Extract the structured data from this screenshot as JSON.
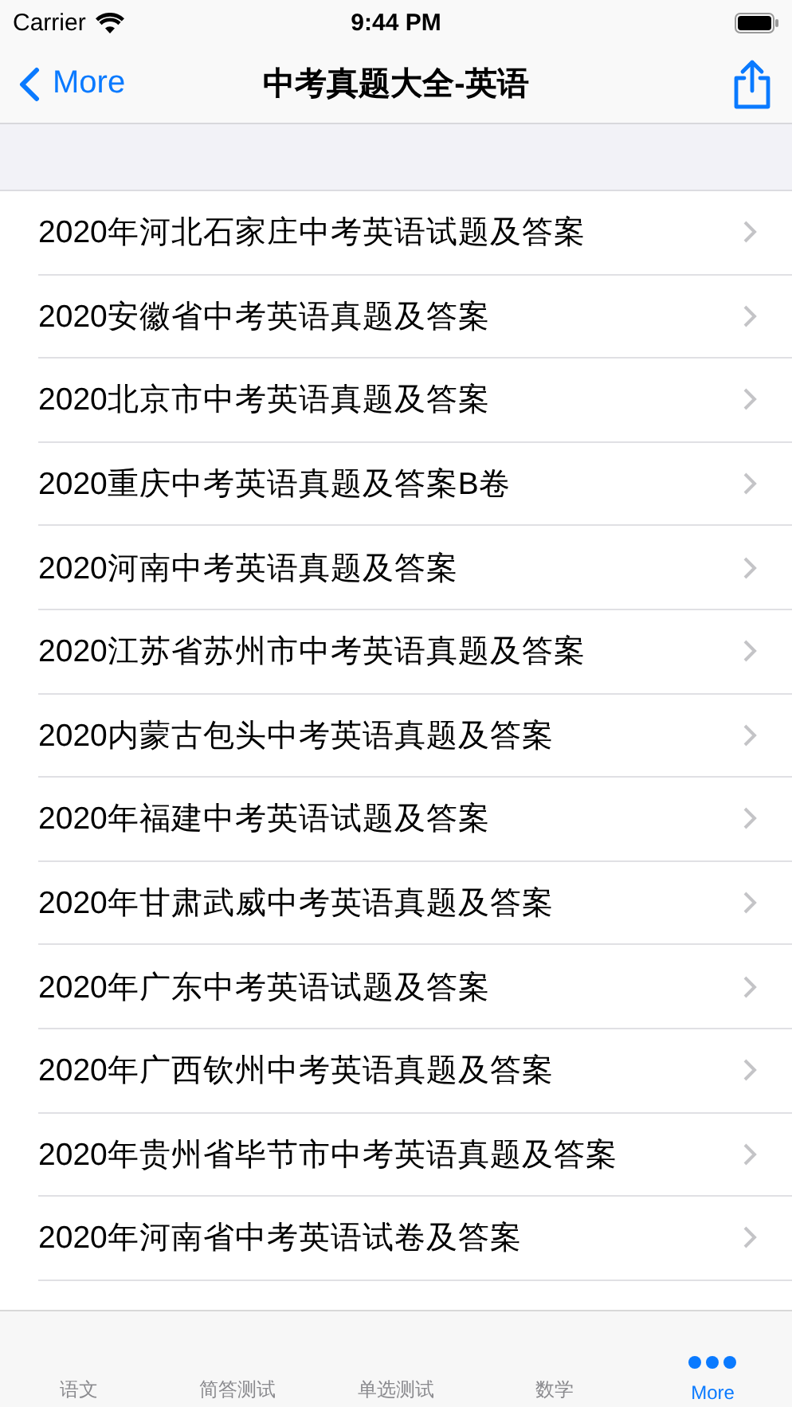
{
  "status_bar": {
    "carrier": "Carrier",
    "time": "9:44 PM"
  },
  "nav": {
    "back": "More",
    "title": "中考真题大全-英语"
  },
  "rows": [
    "2020年河北石家庄中考英语试题及答案",
    "2020安徽省中考英语真题及答案",
    "2020北京市中考英语真题及答案",
    "2020重庆中考英语真题及答案B卷",
    "2020河南中考英语真题及答案",
    "2020江苏省苏州市中考英语真题及答案",
    "2020内蒙古包头中考英语真题及答案",
    "2020年福建中考英语试题及答案",
    "2020年甘肃武威中考英语真题及答案",
    "2020年广东中考英语试题及答案",
    "2020年广西钦州中考英语真题及答案",
    "2020年贵州省毕节市中考英语真题及答案",
    "2020年河南省中考英语试卷及答案"
  ],
  "tabs": [
    {
      "label": "语文",
      "selected": false
    },
    {
      "label": "简答测试",
      "selected": false
    },
    {
      "label": "单选测试",
      "selected": false
    },
    {
      "label": "数学",
      "selected": false
    },
    {
      "label": "More",
      "selected": true,
      "kind": "more"
    }
  ]
}
